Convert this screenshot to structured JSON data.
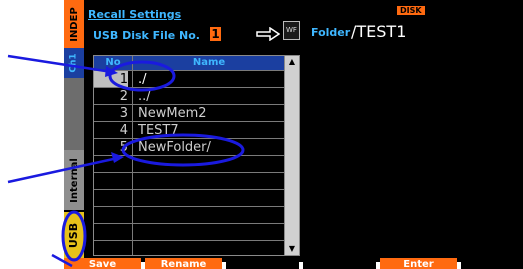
{
  "header": {
    "title": "Recall Settings",
    "disk_badge": "DISK",
    "usb_file_label": "USB Disk File No.",
    "file_number": "1",
    "wf_icon_text": "WF",
    "folder_label": "Folder",
    "folder_path": "/TEST1"
  },
  "side_tabs": {
    "indep": "INDEP",
    "channel": "Ch1",
    "internal": "Internal",
    "usb": "USB"
  },
  "table": {
    "col_no": "No",
    "col_name": "Name",
    "rows": [
      {
        "no": "1",
        "name": "./"
      },
      {
        "no": "2",
        "name": "../"
      },
      {
        "no": "3",
        "name": "NewMem2"
      },
      {
        "no": "4",
        "name": "TEST7"
      },
      {
        "no": "5",
        "name": "NewFolder/"
      }
    ]
  },
  "softkeys": [
    "Save",
    "Rename",
    "",
    "",
    "Enter",
    ""
  ],
  "colors": {
    "accent": "#3fb7ff",
    "orange": "#ff6a10",
    "annotation": "#1a1adf"
  }
}
